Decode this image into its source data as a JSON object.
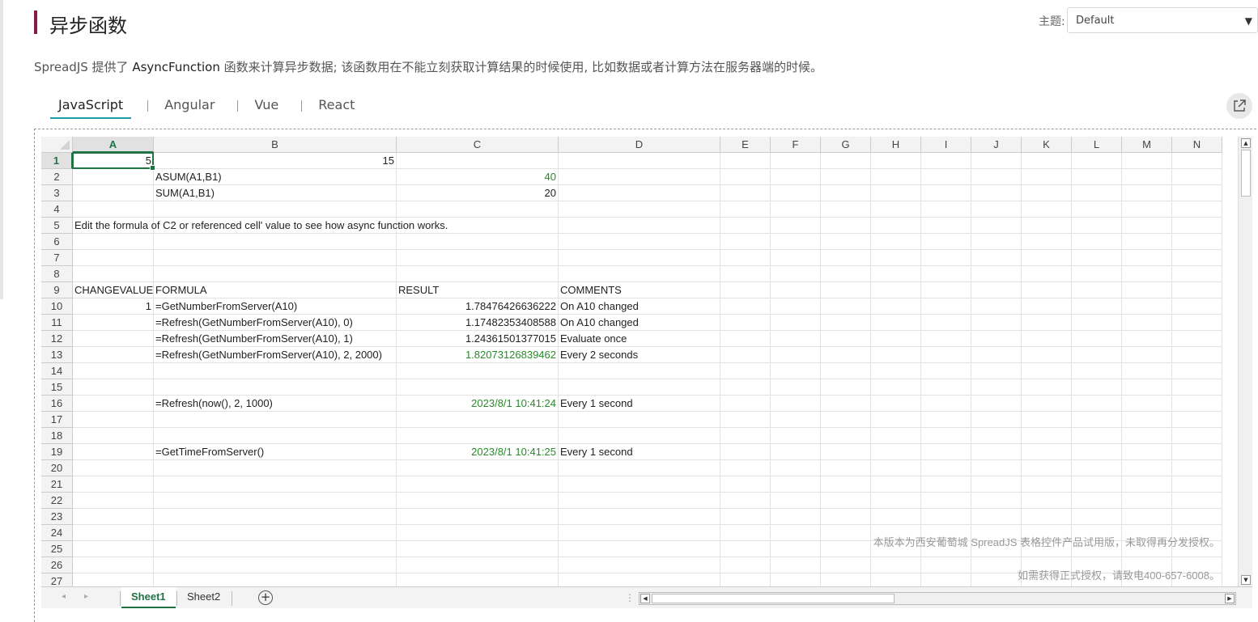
{
  "page": {
    "title": "异步函数",
    "theme_label": "主题:",
    "theme_value": "Default",
    "description_pre": "SpreadJS 提供了 ",
    "description_fn": "AsyncFunction",
    "description_post": " 函数来计算异步数据; 该函数用在不能立刻获取计算结果的时候使用, 比如数据或者计算方法在服务器端的时候。",
    "accent_color": "#8b1a4a",
    "tab_underline_color": "#1e9aa8"
  },
  "framework_tabs": [
    {
      "label": "JavaScript",
      "active": true
    },
    {
      "label": "Angular",
      "active": false
    },
    {
      "label": "Vue",
      "active": false
    },
    {
      "label": "React",
      "active": false
    }
  ],
  "popout_icon": "external-link-icon",
  "spreadsheet": {
    "columns": [
      "A",
      "B",
      "C",
      "D",
      "E",
      "F",
      "G",
      "H",
      "I",
      "J",
      "K",
      "L",
      "M",
      "N"
    ],
    "selected_column": "A",
    "selected_row": 1,
    "rows": [
      "1",
      "2",
      "3",
      "4",
      "5",
      "6",
      "7",
      "8",
      "9",
      "10",
      "11",
      "12",
      "13",
      "14",
      "15",
      "16",
      "17",
      "18",
      "19",
      "20",
      "21",
      "22",
      "23",
      "24",
      "25",
      "26",
      "27"
    ],
    "cells": {
      "A1": "5",
      "B1": "15",
      "B2": "ASUM(A1,B1)",
      "C2": "40",
      "B3": "SUM(A1,B1)",
      "C3": "20",
      "A5": "Edit the formula of C2 or referenced cell' value to see how async function works.",
      "A9": "CHANGEVALUE",
      "B9": "FORMULA",
      "C9": "RESULT",
      "D9": "COMMENTS",
      "A10": "1",
      "B10": "=GetNumberFromServer(A10)",
      "C10": "1.78476426636222",
      "D10": "On A10 changed",
      "B11": "=Refresh(GetNumberFromServer(A10), 0)",
      "C11": "1.17482353408588",
      "D11": "On A10 changed",
      "B12": "=Refresh(GetNumberFromServer(A10), 1)",
      "C12": "1.24361501377015",
      "D12": "Evaluate once",
      "B13": "=Refresh(GetNumberFromServer(A10), 2, 2000)",
      "C13": "1.82073126839462",
      "D13": "Every 2 seconds",
      "B16": "=Refresh(now(), 2, 1000)",
      "C16": "2023/8/1 10:41:24",
      "D16": "Every 1 second",
      "B19": "=GetTimeFromServer()",
      "C19": "2023/8/1 10:41:25",
      "D19": "Every 1 second"
    },
    "watermark_line1": "本版本为西安葡萄城 SpreadJS 表格控件产品试用版，未取得再分发授权。",
    "watermark_line2": "如需获得正式授权，请致电400-657-6008。",
    "sheet_tabs": [
      {
        "label": "Sheet1",
        "active": true
      },
      {
        "label": "Sheet2",
        "active": false
      }
    ],
    "add_sheet_icon": "plus-circle-icon",
    "grid_accent": "#217346",
    "result_color": "#2a8a2a"
  }
}
